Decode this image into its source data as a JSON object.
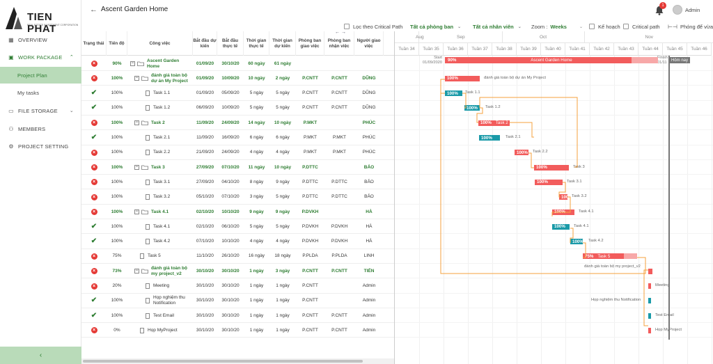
{
  "brand": {
    "name": "TIEN PHAT",
    "tagline": "REAL ESTATE INVESTMENT CORPORATION"
  },
  "sidebar": {
    "items": [
      {
        "label": "OVERVIEW",
        "icon": "grid-icon"
      },
      {
        "label": "WORK PACKAGE",
        "icon": "package-icon"
      },
      {
        "label": "Project Plan"
      },
      {
        "label": "My tasks"
      },
      {
        "label": "FILE STORAGE",
        "icon": "folder-icon"
      },
      {
        "label": "MEMBERS",
        "icon": "user-icon"
      },
      {
        "label": "PROJECT SETTING",
        "icon": "gear-icon"
      }
    ],
    "collapse": "‹"
  },
  "header": {
    "back": "←",
    "title": "Ascent Garden Home",
    "notifications": "1",
    "user": "Admin"
  },
  "toolbar": {
    "critical_filter": "Lọc theo Critical Path",
    "dept": "Tất cả phòng ban",
    "staff": "Tất cả nhân viên",
    "zoom_label": "Zoom :",
    "zoom_value": "Weeks",
    "plan": "Kế hoạch",
    "critical": "Critical path",
    "fullscreen": "Phóng để vừa"
  },
  "table": {
    "headers": [
      "Trạng thái",
      "Tiến độ",
      "Công việc",
      "Bắt đầu dự kiến",
      "Bắt đầu thực tế",
      "Thời gian thực tế",
      "Thời gian dự kiến",
      "Phòng ban giao việc",
      "Phòng ban nhận việc",
      "Người giao việc"
    ],
    "rows": [
      {
        "status": "x",
        "progress": "90%",
        "name": "Ascent Garden Home",
        "start_plan": "01/09/20",
        "start_real": "30/10/20",
        "dur_real": "60 ngày",
        "dur_plan": "61 ngày",
        "dept_from": "",
        "dept_to": "",
        "assigner": "",
        "extra": ""
      },
      {
        "status": "x",
        "progress": "100%",
        "name": "đánh giá toàn bộ dự án My Project",
        "start_plan": "01/09/20",
        "start_real": "10/09/20",
        "dur_real": "10 ngày",
        "dur_plan": "2 ngày",
        "dept_from": "P.CNTT",
        "dept_to": "P.CNTT",
        "assigner": "DŨNG",
        "extra": ""
      },
      {
        "status": "ok",
        "progress": "100%",
        "name": "Task 1.1",
        "start_plan": "01/09/20",
        "start_real": "05/09/20",
        "dur_real": "5 ngày",
        "dur_plan": "5 ngày",
        "dept_from": "P.CNTT",
        "dept_to": "P.CNTT",
        "assigner": "DŨNG",
        "extra": ""
      },
      {
        "status": "ok",
        "progress": "100%",
        "name": "Task 1.2",
        "start_plan": "06/09/20",
        "start_real": "10/09/20",
        "dur_real": "5 ngày",
        "dur_plan": "5 ngày",
        "dept_from": "P.CNTT",
        "dept_to": "P.CNTT",
        "assigner": "DŨNG",
        "extra": ""
      },
      {
        "status": "x",
        "progress": "100%",
        "name": "Task 2",
        "start_plan": "11/09/20",
        "start_real": "24/09/20",
        "dur_real": "14 ngày",
        "dur_plan": "10 ngày",
        "dept_from": "P.MKT",
        "dept_to": "",
        "assigner": "PHÚC",
        "extra": ""
      },
      {
        "status": "ok",
        "progress": "100%",
        "name": "Task 2.1",
        "start_plan": "11/09/20",
        "start_real": "16/09/20",
        "dur_real": "6 ngày",
        "dur_plan": "6 ngày",
        "dept_from": "P.MKT",
        "dept_to": "P.MKT",
        "assigner": "PHÚC",
        "extra": ""
      },
      {
        "status": "x",
        "progress": "100%",
        "name": "Task 2.2",
        "start_plan": "21/09/20",
        "start_real": "24/09/20",
        "dur_real": "4 ngày",
        "dur_plan": "4 ngày",
        "dept_from": "P.MKT",
        "dept_to": "P.MKT",
        "assigner": "PHÚC",
        "extra": ""
      },
      {
        "status": "x",
        "progress": "100%",
        "name": "Task 3",
        "start_plan": "27/09/20",
        "start_real": "07/10/20",
        "dur_real": "11 ngày",
        "dur_plan": "10 ngày",
        "dept_from": "P.DTTC",
        "dept_to": "",
        "assigner": "BẢO",
        "extra": ""
      },
      {
        "status": "x",
        "progress": "100%",
        "name": "Task 3.1",
        "start_plan": "27/09/20",
        "start_real": "04/10/20",
        "dur_real": "8 ngày",
        "dur_plan": "9 ngày",
        "dept_from": "P.DTTC",
        "dept_to": "P.DTTC",
        "assigner": "BẢO",
        "extra": ""
      },
      {
        "status": "x",
        "progress": "100%",
        "name": "Task 3.2",
        "start_plan": "05/10/20",
        "start_real": "07/10/20",
        "dur_real": "3 ngày",
        "dur_plan": "5 ngày",
        "dept_from": "P.DTTC",
        "dept_to": "P.DTTC",
        "assigner": "BẢO",
        "extra": ""
      },
      {
        "status": "x",
        "progress": "100%",
        "name": "Task 4.1",
        "start_plan": "02/10/20",
        "start_real": "10/10/20",
        "dur_real": "9 ngày",
        "dur_plan": "9 ngày",
        "dept_from": "P.DVKH",
        "dept_to": "",
        "assigner": "HÀ",
        "extra": ""
      },
      {
        "status": "ok",
        "progress": "100%",
        "name": "Task 4.1",
        "start_plan": "02/10/20",
        "start_real": "06/10/20",
        "dur_real": "5 ngày",
        "dur_plan": "5 ngày",
        "dept_from": "P.DVKH",
        "dept_to": "P.DVKH",
        "assigner": "HÀ",
        "extra": "Pl"
      },
      {
        "status": "ok",
        "progress": "100%",
        "name": "Task 4.2",
        "start_plan": "07/10/20",
        "start_real": "10/10/20",
        "dur_real": "4 ngày",
        "dur_plan": "4 ngày",
        "dept_from": "P.DVKH",
        "dept_to": "P.DVKH",
        "assigner": "HÀ",
        "extra": "Pl"
      },
      {
        "status": "x",
        "progress": "75%",
        "name": "Task 5",
        "start_plan": "11/10/20",
        "start_real": "26/10/20",
        "dur_real": "16 ngày",
        "dur_plan": "18 ngày",
        "dept_from": "P.PLDA",
        "dept_to": "P.PLDA",
        "assigner": "LINH",
        "extra": "H"
      },
      {
        "status": "x",
        "progress": "73%",
        "name": "đánh giá toàn bộ my project_v2",
        "start_plan": "30/10/20",
        "start_real": "30/10/20",
        "dur_real": "1 ngày",
        "dur_plan": "3 ngày",
        "dept_from": "P.CNTT",
        "dept_to": "P.CNTT",
        "assigner": "TIẾN",
        "extra": ""
      },
      {
        "status": "x",
        "progress": "20%",
        "name": "Meeting",
        "start_plan": "30/10/20",
        "start_real": "30/10/20",
        "dur_real": "1 ngày",
        "dur_plan": "1 ngày",
        "dept_from": "P.CNTT",
        "dept_to": "",
        "assigner": "Admin",
        "extra": ""
      },
      {
        "status": "ok",
        "progress": "100%",
        "name": "Họp nghiệm thu Notification",
        "start_plan": "30/10/20",
        "start_real": "30/10/20",
        "dur_real": "1 ngày",
        "dur_plan": "1 ngày",
        "dept_from": "P.CNTT",
        "dept_to": "",
        "assigner": "Admin",
        "extra": ""
      },
      {
        "status": "ok",
        "progress": "100%",
        "name": "Test Email",
        "start_plan": "30/10/20",
        "start_real": "30/10/20",
        "dur_real": "1 ngày",
        "dur_plan": "1 ngày",
        "dept_from": "P.CNTT",
        "dept_to": "P.CNTT",
        "assigner": "Admin",
        "extra": ""
      },
      {
        "status": "x",
        "progress": "0%",
        "name": "Họp MyProject",
        "start_plan": "30/10/20",
        "start_real": "30/10/20",
        "dur_real": "1 ngày",
        "dur_plan": "1 ngày",
        "dept_from": "P.CNTT",
        "dept_to": "P.CNTT",
        "assigner": "Admin",
        "extra": ""
      }
    ]
  },
  "gantt": {
    "months": [
      "Aug",
      "Sep",
      "Oct",
      "Nov"
    ],
    "weeks": [
      "Tuần 34",
      "Tuần 35",
      "Tuần 36",
      "Tuần 37",
      "Tuần 38",
      "Tuần 39",
      "Tuần 40",
      "Tuần 41",
      "Tuần 42",
      "Tuần 43",
      "Tuần 44",
      "Tuần 45",
      "Tuần 46"
    ],
    "start_label": "Start",
    "start_date": "01/09/2020",
    "finish_label": "Finish",
    "finish_date": "01/11",
    "today": "Hôm nay",
    "main_pct": "90%",
    "main_title": "Ascent Garden Home",
    "bars": [
      {
        "pct": "100%",
        "label": "đánh giá toàn bộ dự án My Project"
      },
      {
        "pct": "100%",
        "label": "Task 1.1"
      },
      {
        "pct": "100%",
        "label": "Task 1.2"
      },
      {
        "pct": "100%",
        "label": "Task 2"
      },
      {
        "pct": "100%",
        "label": "Task 2.1"
      },
      {
        "pct": "100%",
        "label": "Task 2.2"
      },
      {
        "pct": "100%",
        "label": "Task 3"
      },
      {
        "pct": "100%",
        "label": "Task 3.1"
      },
      {
        "pct": "100%",
        "label": "Task 3.2"
      },
      {
        "pct": "100%",
        "label": "Task 4.1"
      },
      {
        "pct": "100%",
        "label": "Task 4.1"
      },
      {
        "pct": "100%",
        "label": "Task 4.2"
      },
      {
        "pct": "75%",
        "label": "Task 5"
      },
      {
        "pct": "",
        "label": "đánh giá toàn bộ my project_v2"
      },
      {
        "pct": "",
        "label": "Meeting"
      },
      {
        "pct": "",
        "label": "Họp nghiệm thu Notification"
      },
      {
        "pct": "",
        "label": "Test Email"
      },
      {
        "pct": "",
        "label": "Họp MyProject"
      }
    ],
    "colors": {
      "red": "#f25c5c",
      "teal": "#1a9aa8",
      "orange": "#f5a23c",
      "light": "#f7a8a8"
    }
  }
}
